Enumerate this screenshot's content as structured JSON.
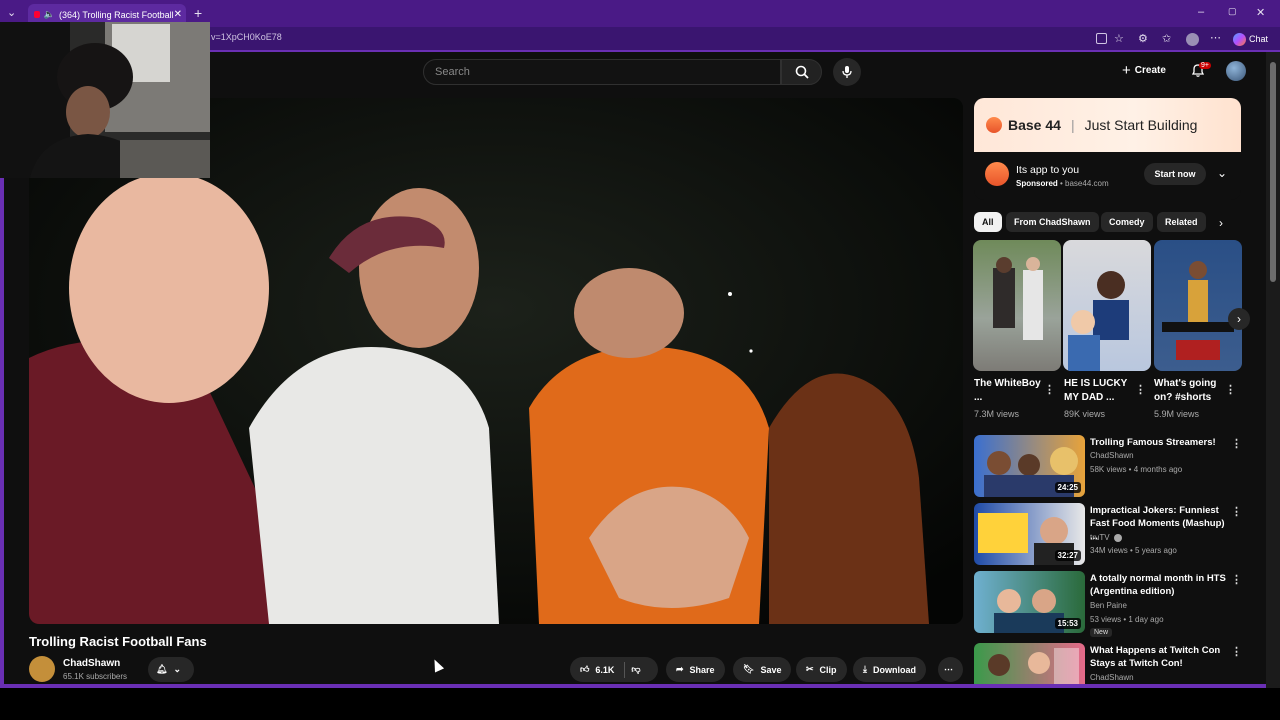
{
  "browser": {
    "tab_title": "(364) Trolling Racist Football",
    "url": "v=1XpCH0KoE78",
    "chat_label": "Chat",
    "window_controls": [
      "–",
      "▢",
      "✕"
    ]
  },
  "header": {
    "search_placeholder": "Search",
    "create_label": "Create",
    "notifications_badge": "9+"
  },
  "video": {
    "title": "Trolling Racist Football Fans",
    "channel_name": "ChadShawn",
    "subscribers": "65.1K subscribers",
    "likes": "6.1K",
    "share_label": "Share",
    "save_label": "Save",
    "clip_label": "Clip",
    "download_label": "Download"
  },
  "ad": {
    "brand": "Base 44",
    "tagline": "Just Start Building",
    "title": "Its app to you",
    "sponsored": "Sponsored",
    "domain": "base44.com",
    "cta": "Start now"
  },
  "chips": [
    "All",
    "From ChadShawn",
    "Comedy",
    "Related"
  ],
  "shorts": [
    {
      "title": "The WhiteBoy ...",
      "views": "7.3M views"
    },
    {
      "title": "HE IS LUCKY MY DAD ...",
      "views": "89K views"
    },
    {
      "title": "What's going on? #shorts",
      "views": "5.9M views"
    }
  ],
  "recommended": [
    {
      "title": "Trolling Famous Streamers!",
      "channel": "ChadShawn",
      "meta": "58K views • 4 months ago",
      "duration": "24:25"
    },
    {
      "title": "Impractical Jokers: Funniest Fast Food Moments (Mashup) ...",
      "channel": "truTV",
      "meta": "34M views • 5 years ago",
      "duration": "32:27"
    },
    {
      "title": "A totally normal month in HTS (Argentina edition)",
      "channel": "Ben Paine",
      "meta": "53 views • 1 day ago",
      "duration": "15:53",
      "badge": "New"
    },
    {
      "title": "What Happens at Twitch Con Stays at Twitch Con!",
      "channel": "ChadShawn",
      "meta": "",
      "duration": ""
    }
  ]
}
